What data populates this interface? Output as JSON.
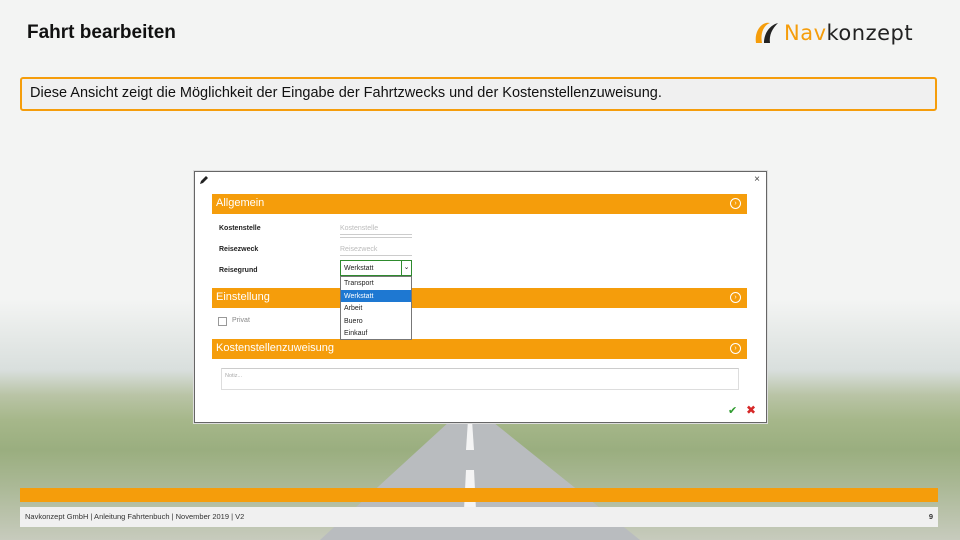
{
  "slide": {
    "title": "Fahrt bearbeiten",
    "intro": "Diese Ansicht zeigt die Möglichkeit der Eingabe der Fahrtzwecks und der Kostenstellenzuweisung."
  },
  "logo": {
    "text_brand": "Nav",
    "text_rest": "konzept",
    "icon": "navkonzept-logo-mark"
  },
  "dialog": {
    "close_label": "×",
    "sections": {
      "allgemein": "Allgemein",
      "einstellung": "Einstellung",
      "kostenstellen": "Kostenstellenzuweisung"
    },
    "fields": {
      "kostenstelle_label": "Kostenstelle",
      "kostenstelle_placeholder": "Kostenstelle",
      "reisezweck_label": "Reisezweck",
      "reisezweck_placeholder": "Reisezweck",
      "reisegrund_label": "Reisegrund",
      "reisegrund_value": "Werkstatt"
    },
    "dropdown_options": [
      "Transport",
      "Werkstatt",
      "Arbeit",
      "Buero",
      "Einkauf"
    ],
    "dropdown_selected": "Werkstatt",
    "privat_label": "Privat",
    "note_placeholder": "Notiz...",
    "ok_icon": "check-icon",
    "cancel_icon": "cross-icon"
  },
  "footer": {
    "text": "Navkonzept GmbH  |  Anleitung Fahrtenbuch  |  November 2019  |  V2",
    "page_number": "9"
  },
  "colors": {
    "accent": "#f59d0b",
    "ok": "#2e9b2e",
    "cancel": "#d62828",
    "selection": "#1e78d2"
  }
}
